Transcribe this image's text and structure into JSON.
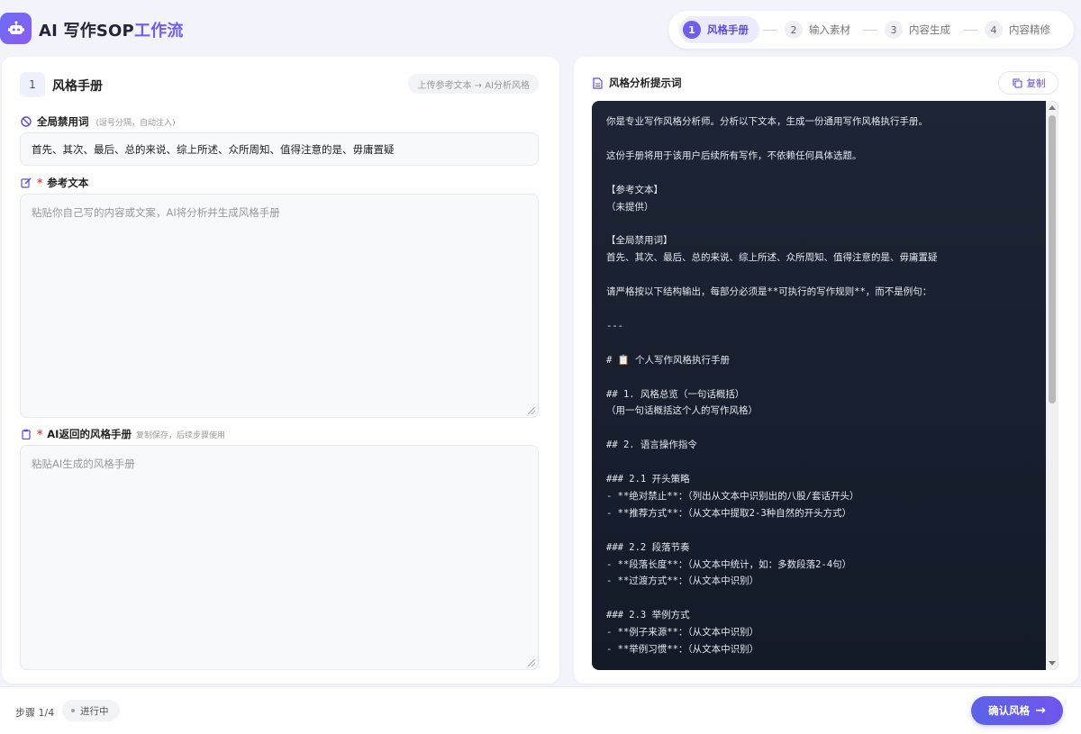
{
  "app": {
    "title_part1": "AI 写作SOP",
    "title_part2": "工作流",
    "logo_icon": "robot-icon"
  },
  "stepper": {
    "steps": [
      {
        "num": "1",
        "label": "风格手册"
      },
      {
        "num": "2",
        "label": "输入素材"
      },
      {
        "num": "3",
        "label": "内容生成"
      },
      {
        "num": "4",
        "label": "内容精修"
      }
    ]
  },
  "left_panel": {
    "step_num": "1",
    "title": "风格手册",
    "hint": "上传参考文本 → AI分析风格",
    "banned": {
      "label": "全局禁用词",
      "sub": "(逗号分隔，自动注入)",
      "value": "首先、其次、最后、总的来说、综上所述、众所周知、值得注意的是、毋庸置疑"
    },
    "reference": {
      "required": "*",
      "label": "参考文本",
      "placeholder": "粘贴你自己写的内容或文案，AI将分析并生成风格手册"
    },
    "manual": {
      "required": "*",
      "label": "AI返回的风格手册",
      "sub": "复制保存，后续步骤使用",
      "placeholder": "粘贴AI生成的风格手册"
    }
  },
  "right_panel": {
    "title": "风格分析提示词",
    "copy_label": "复制",
    "prompt_text": "你是专业写作风格分析师。分析以下文本，生成一份通用写作风格执行手册。\n\n这份手册将用于该用户后续所有写作，不依赖任何具体选题。\n\n【参考文本】\n（未提供）\n\n【全局禁用词】\n首先、其次、最后、总的来说、综上所述、众所周知、值得注意的是、毋庸置疑\n\n请严格按以下结构输出，每部分必须是**可执行的写作规则**，而不是例句：\n\n---\n\n# 📋 个人写作风格执行手册\n\n## 1. 风格总览（一句话概括）\n（用一句话概括这个人的写作风格）\n\n## 2. 语言操作指令\n\n### 2.1 开头策略\n- **绝对禁止**：（列出从文本中识别出的八股/套话开头）\n- **推荐方式**：（从文本中提取2-3种自然的开头方式）\n\n### 2.2 段落节奏\n- **段落长度**：（从文本中统计，如：多数段落2-4句）\n- **过渡方式**：（从文本中识别）\n\n### 2.3 举例方式\n- **例子来源**：（从文本中识别）\n- **举例习惯**：（从文本中识别）"
  },
  "footer": {
    "step_count": "步骤 1/4",
    "status": "进行中",
    "confirm_label": "确认风格",
    "confirm_arrow": "→"
  }
}
